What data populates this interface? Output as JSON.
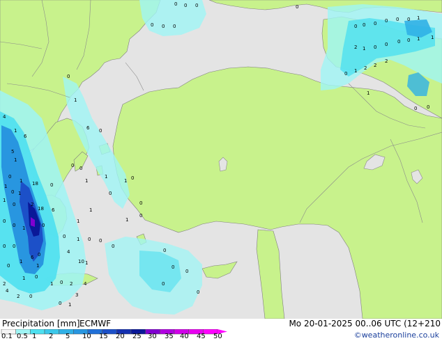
{
  "map": {
    "point_values": [
      "0",
      "0",
      "0",
      "0",
      "0",
      "0",
      "0",
      "0",
      "0",
      "0",
      "0",
      "0",
      "0",
      "1",
      "2",
      "1",
      "0",
      "0",
      "0",
      "0",
      "1",
      "1",
      "0",
      "1",
      "2",
      "2",
      "2",
      "1",
      "0",
      "0",
      "6",
      "0",
      "0",
      "0",
      "1",
      "1",
      "0",
      "0",
      "1",
      "0",
      "0",
      "1",
      "1",
      "0",
      "0",
      "0",
      "0",
      "0",
      "0",
      "0",
      "4",
      "1",
      "6",
      "5",
      "1",
      "0",
      "1",
      "1",
      "0",
      "0",
      "0",
      "1",
      "18",
      "0",
      "1",
      "2",
      "18",
      "6",
      "0",
      "1",
      "1",
      "0",
      "0",
      "0",
      "0",
      "0",
      "1",
      "6",
      "0",
      "1",
      "4",
      "10",
      "1",
      "2",
      "1",
      "0",
      "1",
      "0",
      "2",
      "4",
      "2",
      "0",
      "0",
      "1",
      "3",
      "4",
      "1",
      "0",
      "1",
      "0",
      "0",
      "0"
    ]
  },
  "footer": {
    "title": "Precipitation [mm]",
    "model": "ECMWF",
    "date": "Mo 20-01-2025 00..06 UTC (12+210",
    "credit": "©weatheronline.co.uk"
  },
  "legend": {
    "ticks": [
      "0.1",
      "0.5",
      "1",
      "2",
      "5",
      "10",
      "15",
      "20",
      "25",
      "30",
      "35",
      "40",
      "45",
      "50"
    ],
    "colors": [
      "#f5f5f5",
      "#9ff5f5",
      "#4ee0f0",
      "#3cc8ea",
      "#30b0e6",
      "#2896e0",
      "#2070d8",
      "#1c50c8",
      "#1430b0",
      "#0a1898",
      "#8000d0",
      "#b000e0",
      "#d000e8",
      "#e800f0",
      "#ff00ff"
    ]
  },
  "colors": {
    "land": "#c8f28c",
    "sea": "#e4e4e4",
    "border": "#8a8a8a"
  }
}
